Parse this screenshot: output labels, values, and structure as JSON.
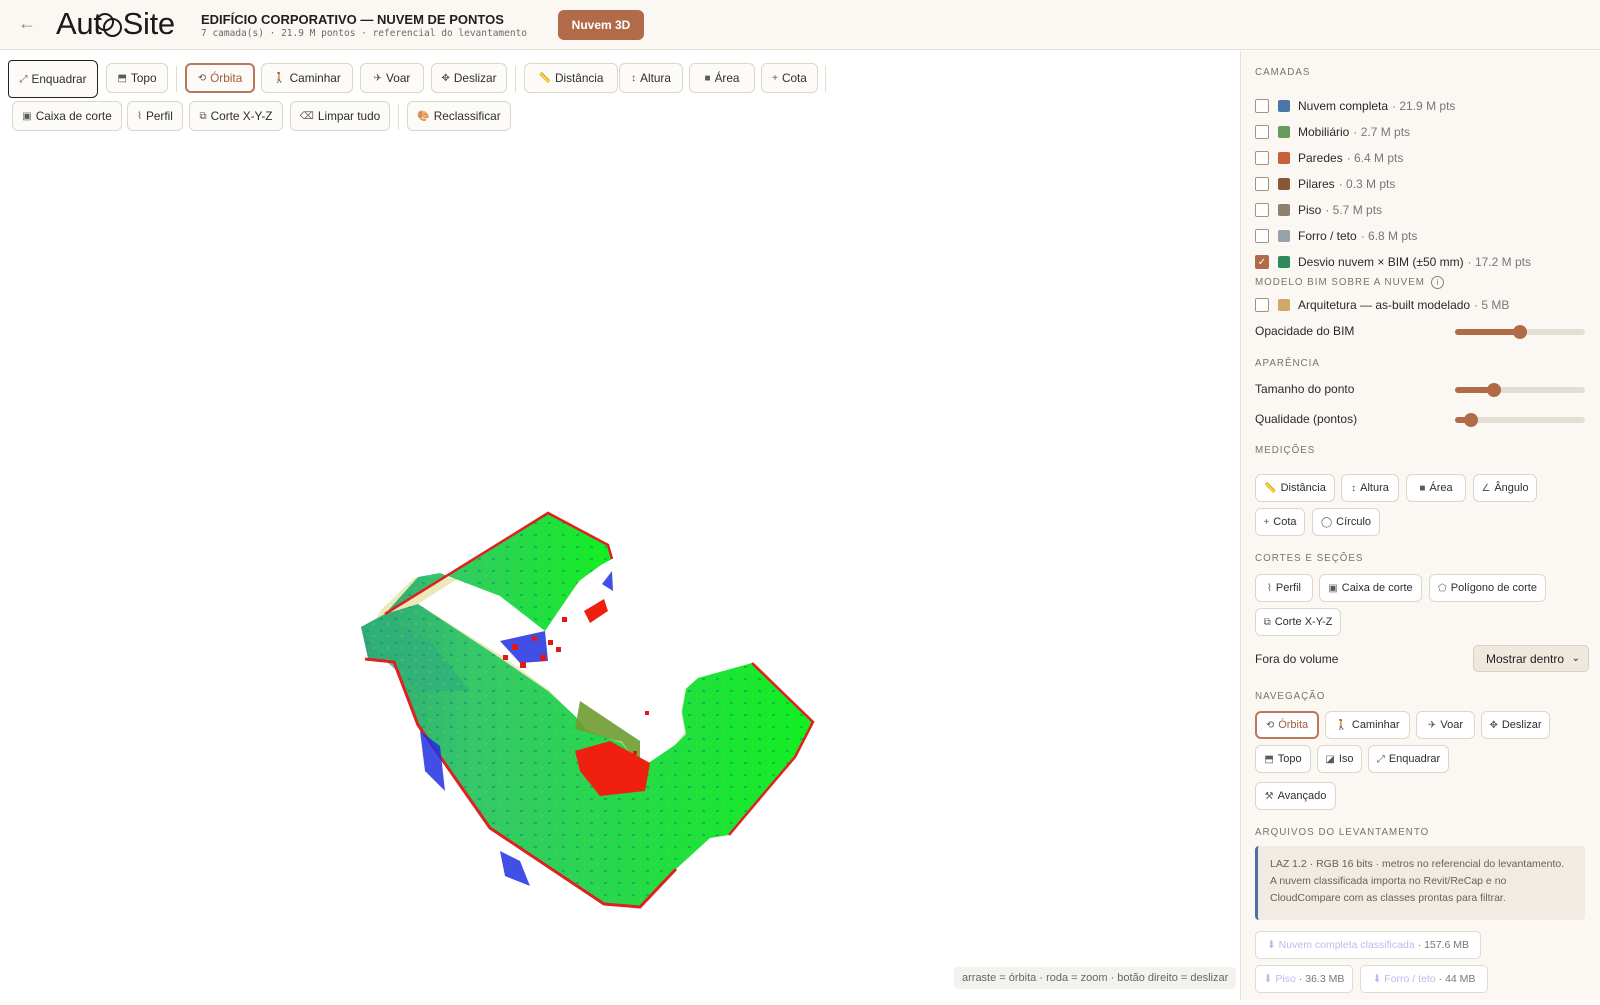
{
  "header": {
    "back": "←",
    "logo_pre": "Aut",
    "logo_post": "Site",
    "title": "EDIFÍCIO CORPORATIVO — NUVEM DE PONTOS",
    "subtitle": "7 camada(s) · 21.9 M pontos · referencial do levantamento",
    "badge": "Nuvem 3D"
  },
  "toolbar": {
    "row1": [
      {
        "icon": "⤢",
        "label": "Enquadrar"
      },
      {
        "icon": "⬒",
        "label": "Topo"
      },
      {
        "icon": "⟲",
        "label": "Órbita"
      },
      {
        "icon": "🚶",
        "label": "Caminhar"
      },
      {
        "icon": "✈",
        "label": "Voar"
      },
      {
        "icon": "✥",
        "label": "Deslizar"
      },
      {
        "icon": "📏",
        "label": "Distância"
      },
      {
        "icon": "↕",
        "label": "Altura"
      },
      {
        "icon": "■",
        "label": "Área"
      },
      {
        "icon": "+",
        "label": "Cota"
      }
    ],
    "row2": [
      {
        "icon": "▣",
        "label": "Caixa de corte"
      },
      {
        "icon": "⌇",
        "label": "Perfil"
      },
      {
        "icon": "⧉",
        "label": "Corte X-Y-Z"
      },
      {
        "icon": "⌫",
        "label": "Limpar tudo"
      },
      {
        "icon": "🎨",
        "label": "Reclassificar"
      }
    ]
  },
  "hint": "arraste = órbita · roda = zoom · botão direito = deslizar",
  "sidebar": {
    "layers_title": "CAMADAS",
    "layers": [
      {
        "name": "Nuvem completa",
        "count": "· 21.9 M pts",
        "color": "#4b77a8",
        "checked": false
      },
      {
        "name": "Mobiliário",
        "count": "· 2.7 M pts",
        "color": "#6a9a5e",
        "checked": false
      },
      {
        "name": "Paredes",
        "count": "· 6.4 M pts",
        "color": "#c75f3a",
        "checked": false
      },
      {
        "name": "Pilares",
        "count": "· 0.3 M pts",
        "color": "#8a5638",
        "checked": false
      },
      {
        "name": "Piso",
        "count": "· 5.7 M pts",
        "color": "#8d806d",
        "checked": false
      },
      {
        "name": "Forro / teto",
        "count": "· 6.8 M pts",
        "color": "#98a2ac",
        "checked": false
      },
      {
        "name": "Desvio nuvem × BIM (±50 mm)",
        "count": "· 17.2 M pts",
        "color": "#2e8a5a",
        "checked": true
      }
    ],
    "bim_title": "MODELO BIM SOBRE A NUVEM",
    "bim_info": "i",
    "bim_layer": {
      "name": "Arquitetura — as-built modelado",
      "size": "· 5 MB",
      "color": "#d0a868"
    },
    "bim_opacity_label": "Opacidade do BIM",
    "bim_opacity": 0.5,
    "appearance_title": "APARÊNCIA",
    "point_size_label": "Tamanho do ponto",
    "point_size": 0.3,
    "quality_label": "Qualidade (pontos)",
    "quality": 0.12,
    "measure_title": "MEDIÇÕES",
    "measure": [
      {
        "icon": "📏",
        "label": "Distância"
      },
      {
        "icon": "↕",
        "label": "Altura"
      },
      {
        "icon": "■",
        "label": "Área"
      },
      {
        "icon": "∠",
        "label": "Ângulo"
      },
      {
        "icon": "+",
        "label": "Cota"
      },
      {
        "icon": "◯",
        "label": "Círculo"
      }
    ],
    "cuts_title": "CORTES E SEÇÕES",
    "cuts": [
      {
        "icon": "⌇",
        "label": "Perfil"
      },
      {
        "icon": "▣",
        "label": "Caixa de corte"
      },
      {
        "icon": "⬠",
        "label": "Polígono de corte"
      },
      {
        "icon": "⧉",
        "label": "Corte X-Y-Z"
      }
    ],
    "outside_label": "Fora do volume",
    "outside_value": "Mostrar dentro",
    "nav_title": "NAVEGAÇÃO",
    "nav": [
      {
        "icon": "⟲",
        "label": "Órbita"
      },
      {
        "icon": "🚶",
        "label": "Caminhar"
      },
      {
        "icon": "✈",
        "label": "Voar"
      },
      {
        "icon": "✥",
        "label": "Deslizar"
      },
      {
        "icon": "⬒",
        "label": "Topo"
      },
      {
        "icon": "◪",
        "label": "Iso"
      },
      {
        "icon": "⤢",
        "label": "Enquadrar"
      },
      {
        "icon": "⚒",
        "label": "Avançado"
      }
    ],
    "files_title": "ARQUIVOS DO LEVANTAMENTO",
    "files_info": "LAZ 1.2 · RGB 16 bits · metros no referencial do levantamento. A nuvem classificada importa no Revit/ReCap e no CloudCompare com as classes prontas para filtrar.",
    "files": [
      {
        "name": "⬇ Nuvem completa classificada",
        "size": "· 157.6 MB"
      },
      {
        "name": "⬇ Piso",
        "size": "· 36.3 MB"
      },
      {
        "name": "⬇ Forro / teto",
        "size": "· 44 MB"
      }
    ]
  }
}
